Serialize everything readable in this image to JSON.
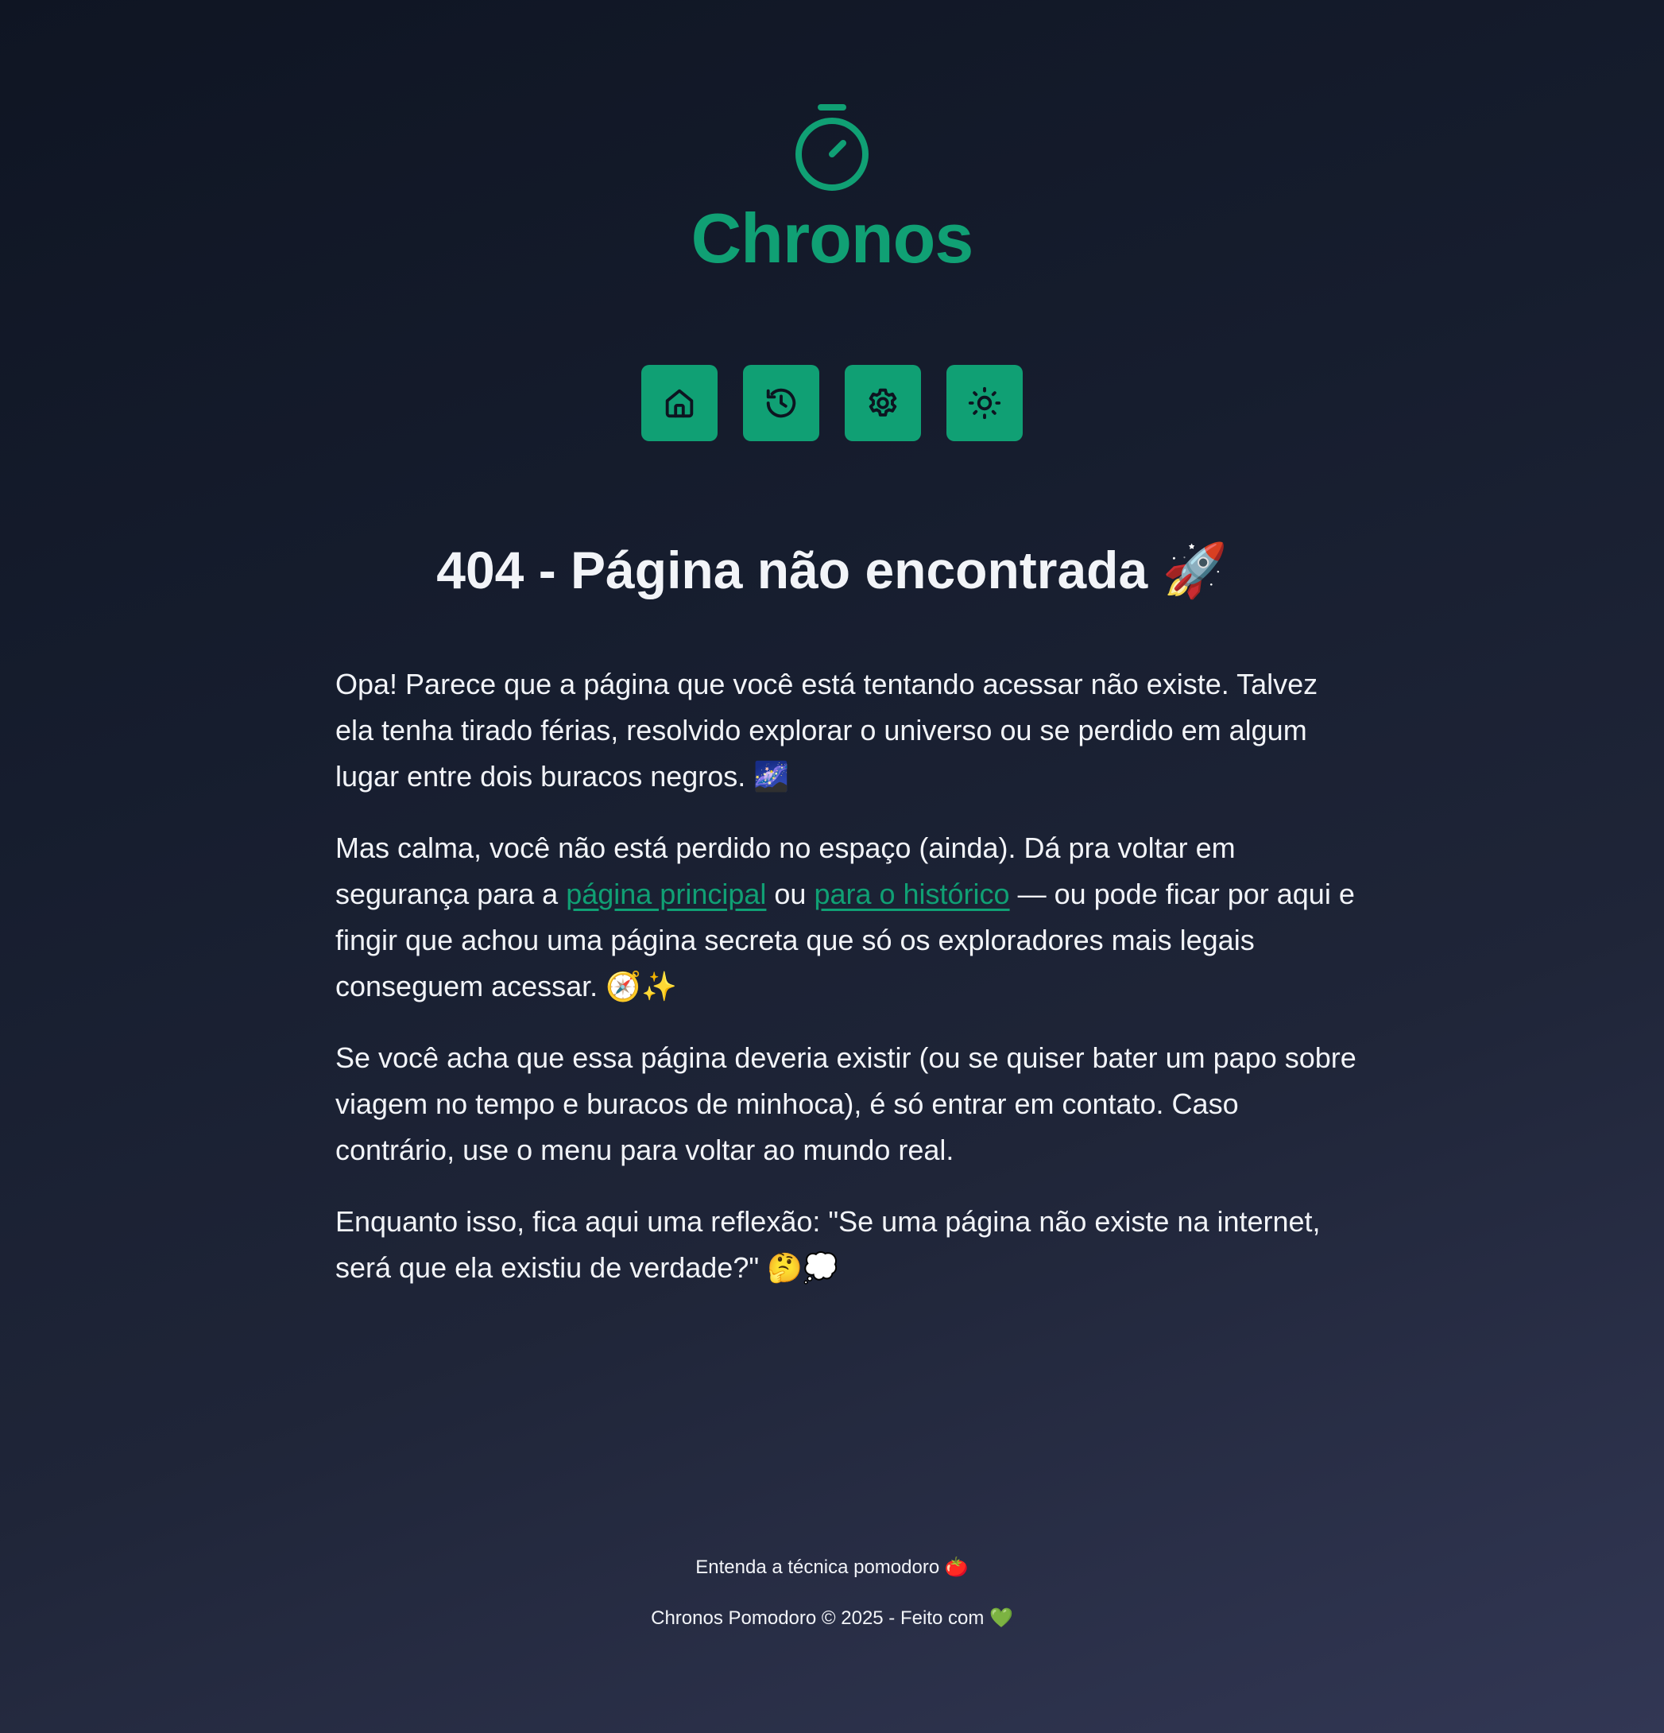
{
  "brand": {
    "name": "Chronos",
    "logo_icon": "stopwatch-icon",
    "accent_color": "#10a074"
  },
  "menu": {
    "items": [
      {
        "icon": "home-icon"
      },
      {
        "icon": "history-icon"
      },
      {
        "icon": "settings-gear-icon"
      },
      {
        "icon": "sun-theme-icon"
      }
    ]
  },
  "page": {
    "title": "404 - Página não encontrada 🚀",
    "paragraph1": "Opa! Parece que a página que você está tentando acessar não existe. Talvez ela tenha tirado férias, resolvido explorar o universo ou se perdido em algum lugar entre dois buracos negros. 🌌",
    "paragraph2": {
      "before": "Mas calma, você não está perdido no espaço (ainda). Dá pra voltar em segurança para a ",
      "link_home": "página principal",
      "middle": " ou ",
      "link_history": "para o histórico",
      "after": " — ou pode ficar por aqui e fingir que achou uma página secreta que só os exploradores mais legais conseguem acessar. 🧭✨"
    },
    "paragraph3": "Se você acha que essa página deveria existir (ou se quiser bater um papo sobre viagem no tempo e buracos de minhoca), é só entrar em contato. Caso contrário, use o menu para voltar ao mundo real.",
    "paragraph4": "Enquanto isso, fica aqui uma reflexão: \"Se uma página não existe na internet, será que ela existiu de verdade?\" 🤔💭"
  },
  "footer": {
    "link": "Entenda a técnica pomodoro 🍅",
    "copyright": "Chronos Pomodoro © 2025 - Feito com 💚"
  }
}
